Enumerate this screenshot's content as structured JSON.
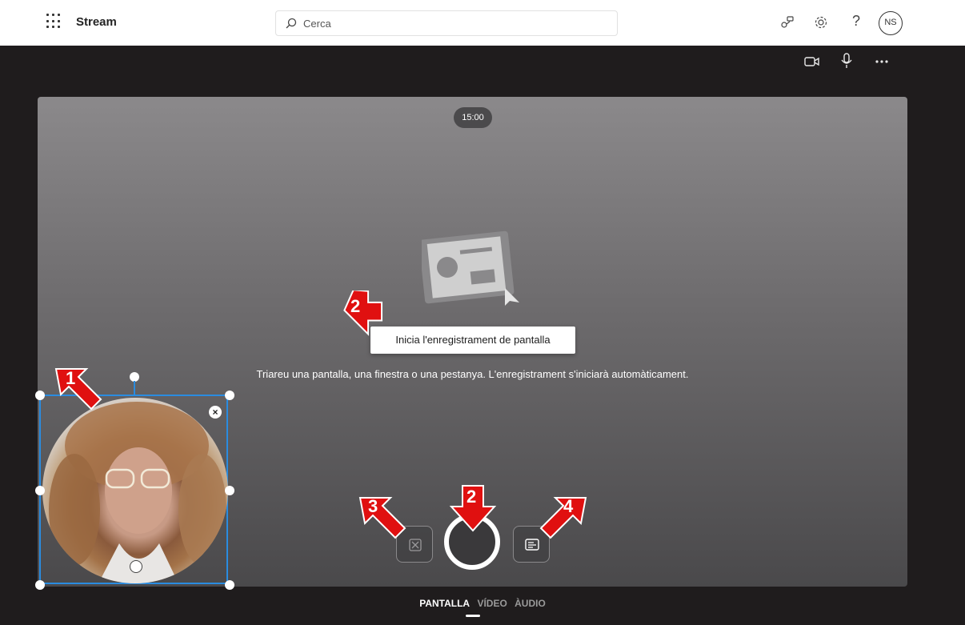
{
  "header": {
    "app_name": "Stream",
    "search_placeholder": "Cerca",
    "avatar_initials": "NS",
    "help_label": "?"
  },
  "toolbar": {
    "icons": [
      "camera-icon",
      "microphone-icon",
      "more-icon"
    ]
  },
  "stage": {
    "timer": "15:00",
    "tooltip": "Inicia l'enregistrament de pantalla",
    "instructions": "Triareu una pantalla, una finestra o una pestanya. L'enregistrament s'iniciarà automàticament."
  },
  "annotations": {
    "arrow_1": "1",
    "arrow_2_top": "2",
    "arrow_2_bottom": "2",
    "arrow_3": "3",
    "arrow_4": "4",
    "arrow_color": "#e01010"
  },
  "tabs": [
    {
      "label": "PANTALLA",
      "active": true
    },
    {
      "label": "VÍDEO",
      "active": false
    },
    {
      "label": "ÀUDIO",
      "active": false
    }
  ],
  "colors": {
    "selection_border": "#2a8ce0",
    "topbar_bg": "#ffffff",
    "app_bg": "#1f1c1d"
  }
}
